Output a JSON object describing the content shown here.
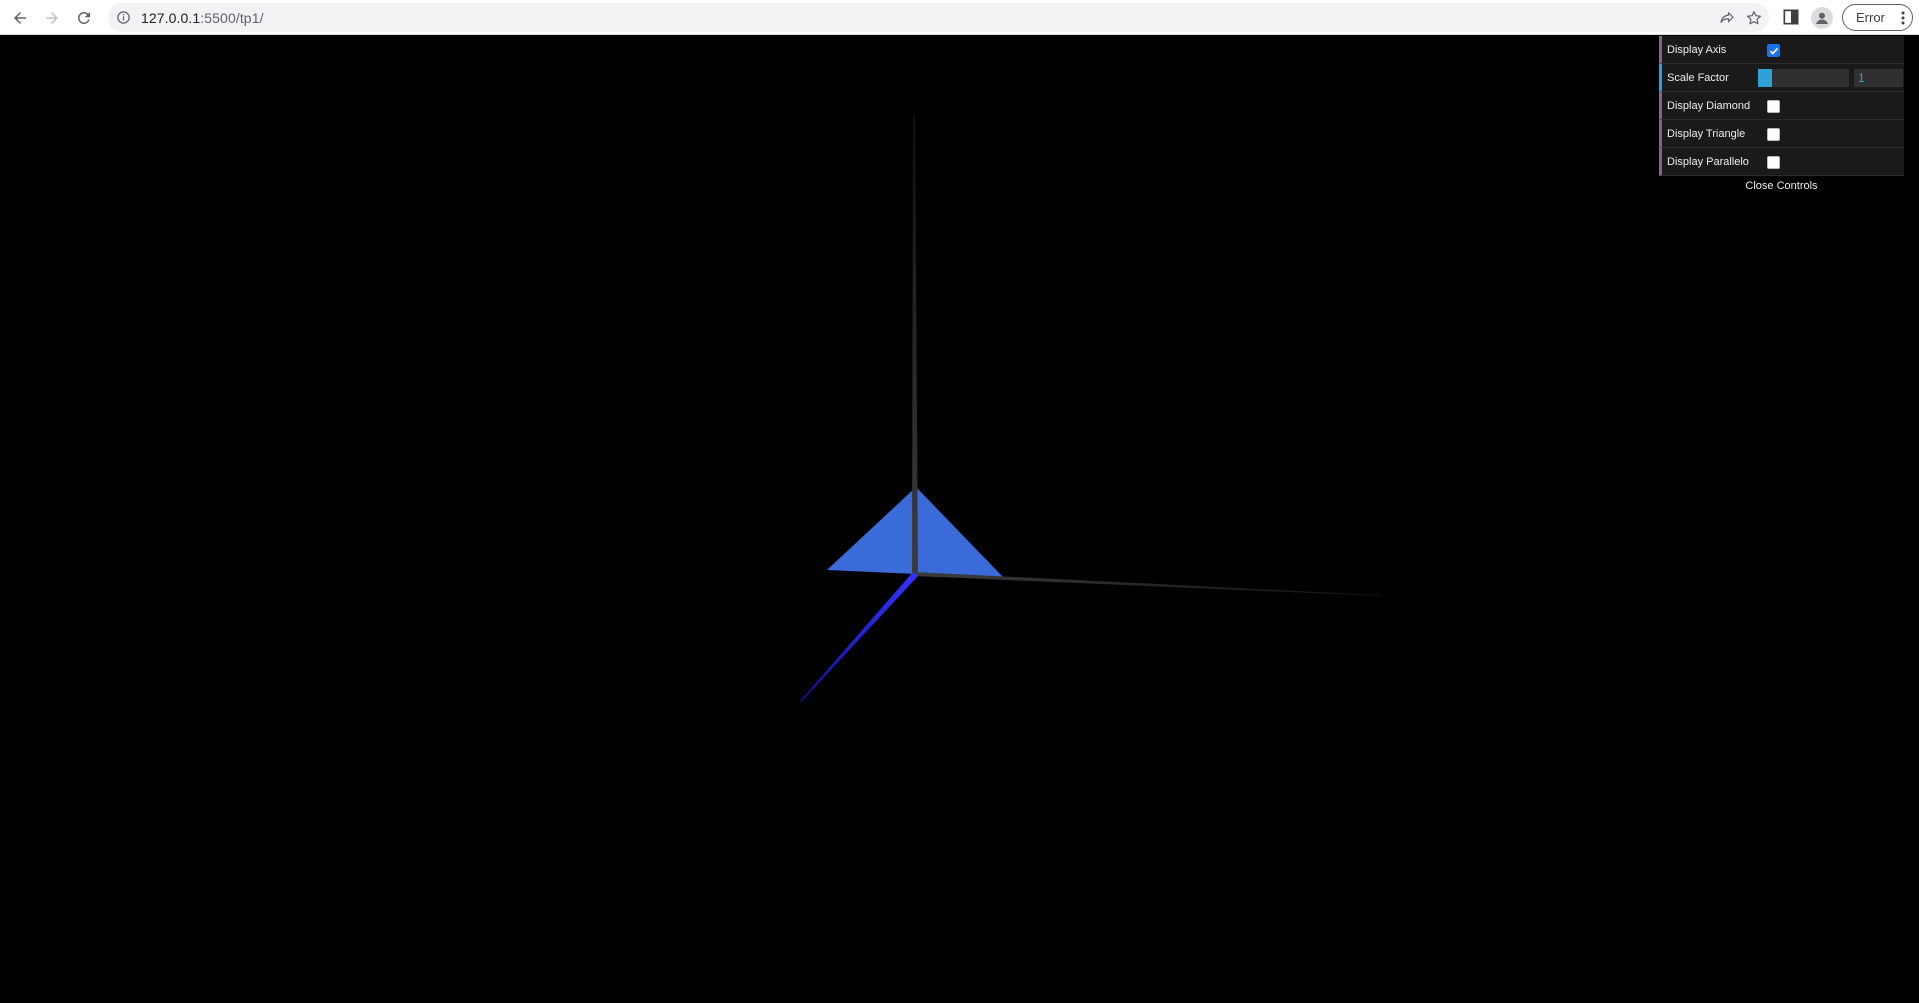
{
  "browser": {
    "url_host": "127.0.0.1",
    "url_rest": ":5500/tp1/",
    "profile_chip": "Error",
    "icons": [
      "back-arrow-icon",
      "forward-arrow-icon",
      "reload-icon",
      "info-icon",
      "share-icon",
      "star-icon",
      "side-panel-icon",
      "profile-icon",
      "kebab-menu-icon"
    ]
  },
  "gui": {
    "controls": [
      {
        "label": "Display Axis",
        "type": "checkbox",
        "checked": true
      },
      {
        "label": "Scale Factor",
        "type": "number",
        "value": "1",
        "fill_fraction": 0.15
      },
      {
        "label": "Display Diamond",
        "type": "checkbox",
        "checked": false
      },
      {
        "label": "Display Triangle",
        "type": "checkbox",
        "checked": false
      },
      {
        "label": "Display Parallelo",
        "type": "checkbox",
        "checked": false
      }
    ],
    "close_label": "Close Controls",
    "colors": {
      "checkbox_accent": "#1a73e8",
      "number_accent": "#2fa1d6",
      "bool_accent": "#806787",
      "panel_bg": "#1a1a1a"
    }
  },
  "scene": {
    "background": "#000000",
    "shape_color": "#3a6bd8",
    "axis_y_color": "#3c3c3c",
    "axis_x_color": "#3c3c3c",
    "axis_z_color": "#2424f0"
  }
}
